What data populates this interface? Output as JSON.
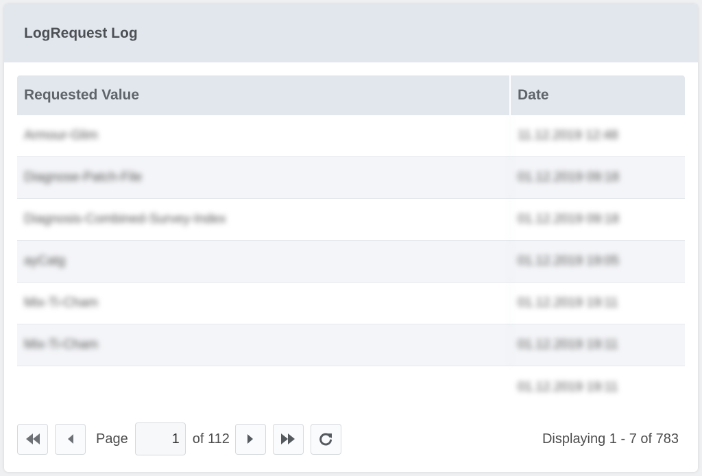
{
  "panel": {
    "title": "LogRequest Log"
  },
  "grid": {
    "columns": [
      "Requested Value",
      "Date"
    ],
    "rows": [
      {
        "value": "Armour-Glim",
        "date": "11.12.2019 12:48"
      },
      {
        "value": "Diagnose-Patch-File",
        "date": "01.12.2019 09:18"
      },
      {
        "value": "Diagnosis-Combined-Survey-Index",
        "date": "01.12.2019 09:18"
      },
      {
        "value": "ayCatg",
        "date": "01.12.2019 19:05"
      },
      {
        "value": "Mix-Ti-Cham",
        "date": "01.12.2019 19:11"
      },
      {
        "value": "Mix-Ti-Cham",
        "date": "01.12.2019 19:11"
      },
      {
        "value": "",
        "date": "01.12.2019 19:11"
      }
    ]
  },
  "pager": {
    "page_label": "Page",
    "current_page": "1",
    "of_label": "of 112",
    "display_text": "Displaying 1 - 7 of 783"
  },
  "icons": {
    "first": "double-chevron-left-icon",
    "prev": "chevron-left-icon",
    "next": "chevron-right-icon",
    "last": "double-chevron-right-icon",
    "refresh": "refresh-icon"
  },
  "colors": {
    "header_bg": "#e2e7ee",
    "row_alt_bg": "#f4f5f8",
    "icon": "#555a5f"
  }
}
